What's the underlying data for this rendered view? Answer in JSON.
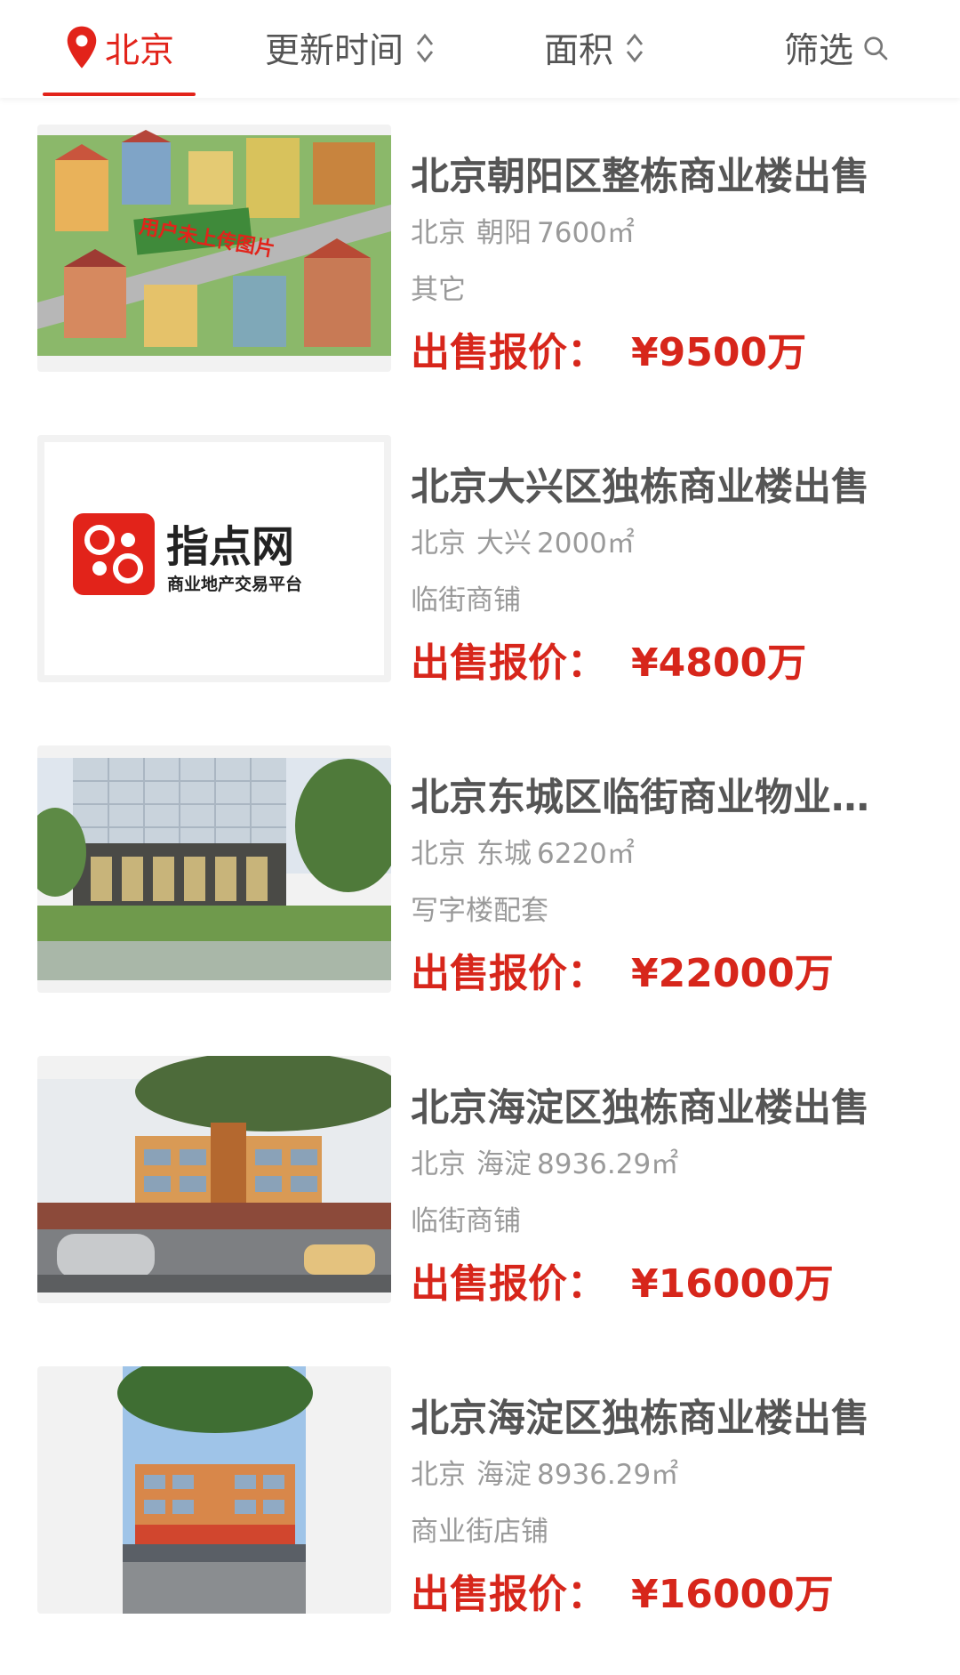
{
  "topbar": {
    "city": "北京",
    "update_label": "更新时间",
    "area_label": "面积",
    "filter_label": "筛选"
  },
  "accent_color": "#e2231a",
  "price_prefix": "出售报价：",
  "listings": [
    {
      "title": "北京朝阳区整栋商业楼出售",
      "city": "北京",
      "district": "朝阳",
      "area": "7600㎡",
      "category": "其它",
      "price": "¥9500万",
      "image_caption": "用户未上传图片"
    },
    {
      "title": "北京大兴区独栋商业楼出售",
      "city": "北京",
      "district": "大兴",
      "area": "2000㎡",
      "category": "临街商铺",
      "price": "¥4800万",
      "logo_name": "指点网",
      "logo_tagline": "商业地产交易平台"
    },
    {
      "title": "北京东城区临街商业物业出售",
      "city": "北京",
      "district": "东城",
      "area": "6220㎡",
      "category": "写字楼配套",
      "price": "¥22000万"
    },
    {
      "title": "北京海淀区独栋商业楼出售",
      "city": "北京",
      "district": "海淀",
      "area": "8936.29㎡",
      "category": "临街商铺",
      "price": "¥16000万"
    },
    {
      "title": "北京海淀区独栋商业楼出售",
      "city": "北京",
      "district": "海淀",
      "area": "8936.29㎡",
      "category": "商业街店铺",
      "price": "¥16000万"
    }
  ]
}
